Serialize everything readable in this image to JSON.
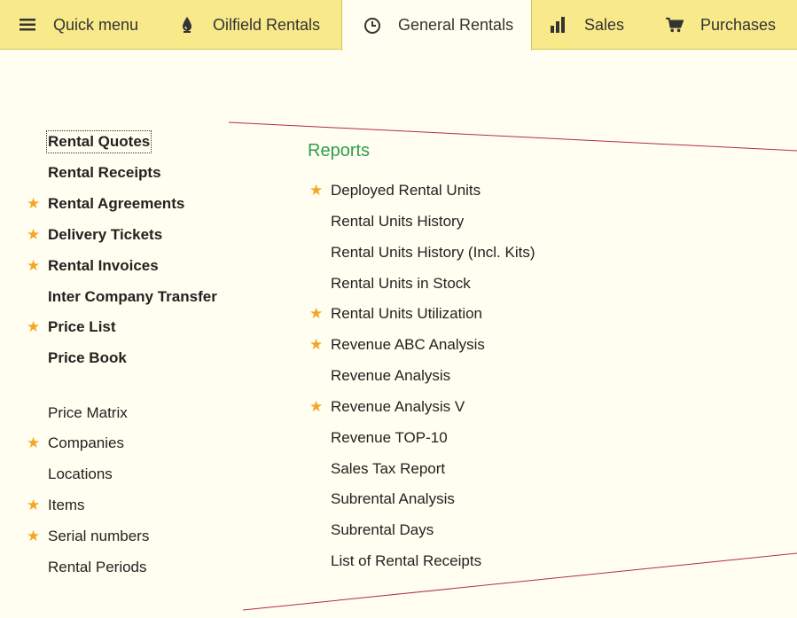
{
  "topbar": {
    "tabs": [
      {
        "label": "Quick menu",
        "icon": "hamburger-menu-icon"
      },
      {
        "label": "Oilfield Rentals",
        "icon": "oil-drop-icon"
      },
      {
        "label": "General Rentals",
        "icon": "clock-icon",
        "active": true
      },
      {
        "label": "Sales",
        "icon": "bar-chart-icon"
      },
      {
        "label": "Purchases",
        "icon": "cart-icon"
      }
    ]
  },
  "left_nav": {
    "primary": [
      {
        "label": "Rental Quotes",
        "starred": false
      },
      {
        "label": "Rental Receipts",
        "starred": false
      },
      {
        "label": "Rental Agreements",
        "starred": true
      },
      {
        "label": "Delivery Tickets",
        "starred": true
      },
      {
        "label": "Rental Invoices",
        "starred": true
      },
      {
        "label": "Inter Company Transfer",
        "starred": false
      },
      {
        "label": "Price List",
        "starred": true
      },
      {
        "label": "Price Book",
        "starred": false
      }
    ],
    "secondary": [
      {
        "label": "Price Matrix",
        "starred": false
      },
      {
        "label": "Companies",
        "starred": true
      },
      {
        "label": "Locations",
        "starred": false
      },
      {
        "label": "Items",
        "starred": true
      },
      {
        "label": "Serial numbers",
        "starred": true
      },
      {
        "label": "Rental Periods",
        "starred": false
      }
    ]
  },
  "reports": {
    "title": "Reports",
    "items": [
      {
        "label": "Deployed Rental Units",
        "starred": true
      },
      {
        "label": "Rental Units History",
        "starred": false
      },
      {
        "label": "Rental Units History (Incl. Kits)",
        "starred": false
      },
      {
        "label": "Rental Units in Stock",
        "starred": false
      },
      {
        "label": "Rental Units Utilization",
        "starred": true
      },
      {
        "label": "Revenue ABC Analysis",
        "starred": true
      },
      {
        "label": "Revenue Analysis",
        "starred": false
      },
      {
        "label": "Revenue Analysis V",
        "starred": true
      },
      {
        "label": "Revenue TOP-10",
        "starred": false
      },
      {
        "label": "Sales Tax Report",
        "starred": false
      },
      {
        "label": "Subrental Analysis",
        "starred": false
      },
      {
        "label": "Subrental Days",
        "starred": false
      },
      {
        "label": "List of Rental Receipts",
        "starred": false
      }
    ]
  },
  "colors": {
    "topbar": "#f8e98a",
    "background": "#fffef0",
    "star": "#f5a623",
    "reports_title": "#2e9e4a",
    "curve": "#b0303a"
  }
}
